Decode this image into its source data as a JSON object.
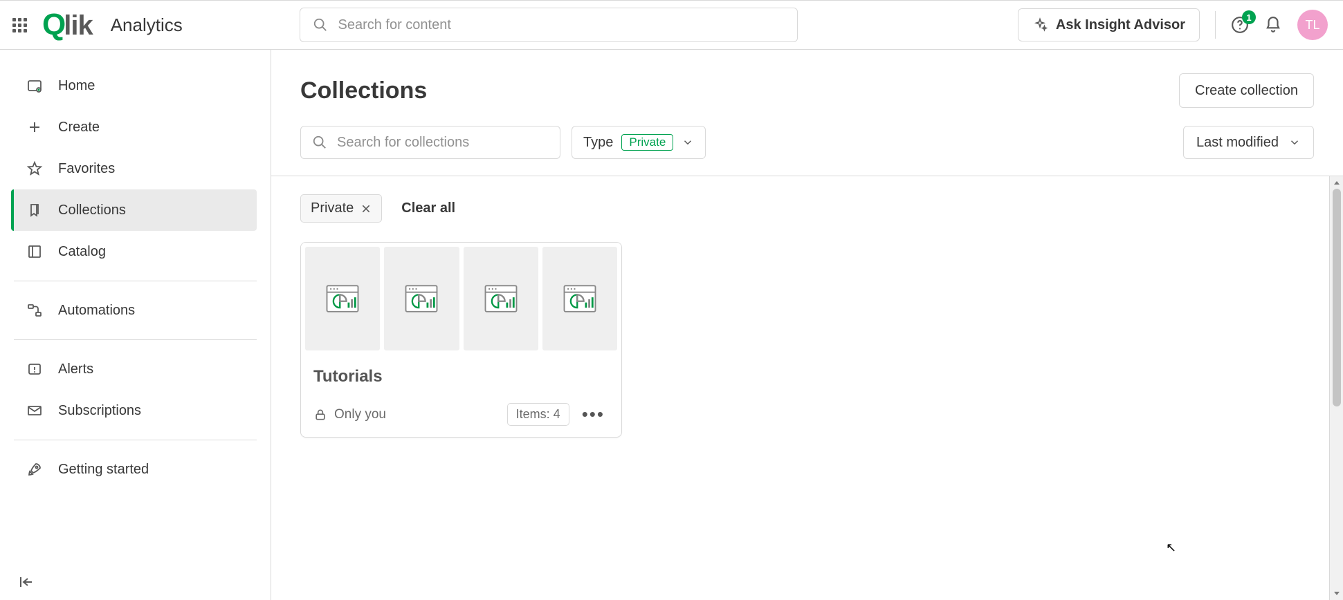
{
  "header": {
    "app_name": "Analytics",
    "search_placeholder": "Search for content",
    "ask_button": "Ask Insight Advisor",
    "help_badge": "1",
    "avatar_initials": "TL"
  },
  "sidebar": {
    "items": [
      {
        "label": "Home"
      },
      {
        "label": "Create"
      },
      {
        "label": "Favorites"
      },
      {
        "label": "Collections"
      },
      {
        "label": "Catalog"
      },
      {
        "label": "Automations"
      },
      {
        "label": "Alerts"
      },
      {
        "label": "Subscriptions"
      },
      {
        "label": "Getting started"
      }
    ]
  },
  "page": {
    "title": "Collections",
    "create_button": "Create collection",
    "search_placeholder": "Search for collections",
    "type_filter_label": "Type",
    "type_filter_value": "Private",
    "sort_label": "Last modified",
    "active_filter": "Private",
    "clear_all": "Clear all"
  },
  "collections": [
    {
      "name": "Tutorials",
      "visibility": "Only you",
      "items_label": "Items: 4",
      "thumbnail_count": 4
    }
  ]
}
